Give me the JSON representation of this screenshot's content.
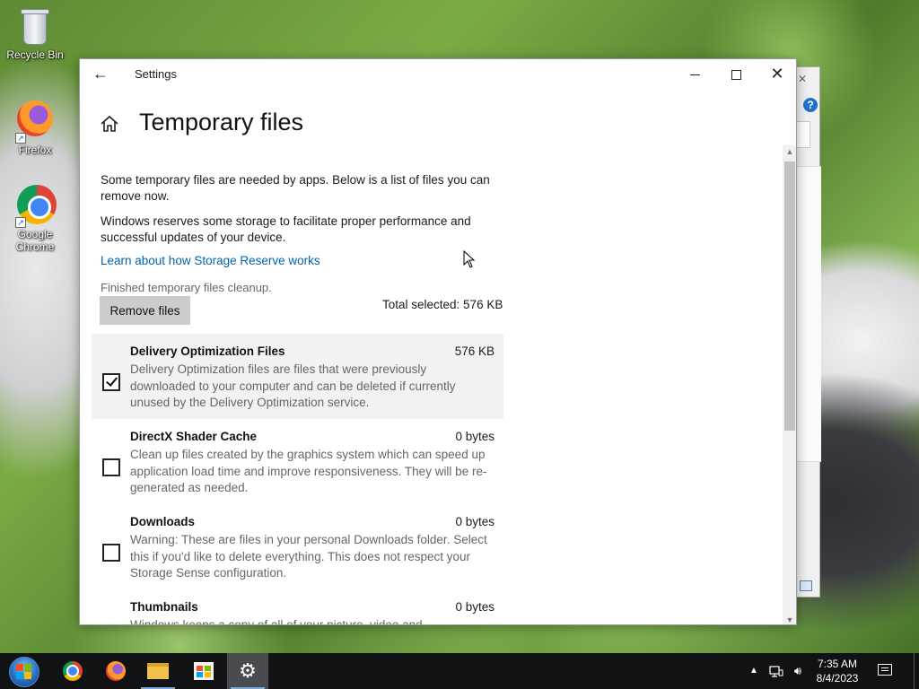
{
  "desktop": {
    "icons": [
      {
        "label": "Recycle Bin",
        "icon": "recycle-bin-icon"
      },
      {
        "label": "Firefox",
        "icon": "firefox-icon"
      },
      {
        "label": "Google Chrome",
        "icon": "chrome-icon"
      }
    ]
  },
  "window": {
    "title": "Settings",
    "back_icon": "back-arrow-icon",
    "minimize_icon": "minimize-icon",
    "maximize_icon": "maximize-icon",
    "close_icon": "close-icon"
  },
  "page": {
    "home_icon": "home-icon",
    "title": "Temporary files",
    "description_1": "Some temporary files are needed by apps. Below is a list of files you can remove now.",
    "description_2": "Windows reserves some storage to facilitate proper performance and successful updates of your device.",
    "link": "Learn about how Storage Reserve works",
    "status": "Finished temporary files cleanup.",
    "remove_button": "Remove files",
    "total_selected": "Total selected: 576 KB",
    "items": [
      {
        "name": "Delivery Optimization Files",
        "size": "576 KB",
        "checked": true,
        "description": "Delivery Optimization files are files that were previously downloaded to your computer and can be deleted if currently unused by the Delivery Optimization service."
      },
      {
        "name": "DirectX Shader Cache",
        "size": "0 bytes",
        "checked": false,
        "description": "Clean up files created by the graphics system which can speed up application load time and improve responsiveness. They will be re-generated as needed."
      },
      {
        "name": "Downloads",
        "size": "0 bytes",
        "checked": false,
        "description": "Warning: These are files in your personal Downloads folder. Select this if you'd like to delete everything. This does not respect your Storage Sense configuration."
      },
      {
        "name": "Thumbnails",
        "size": "0 bytes",
        "checked": false,
        "description": "Windows keeps a copy of all of your picture, video and"
      }
    ]
  },
  "taskbar": {
    "start_icon": "windows-start-icon",
    "apps": [
      {
        "name": "chrome-icon",
        "running": false,
        "active": false
      },
      {
        "name": "firefox-icon",
        "running": false,
        "active": false
      },
      {
        "name": "file-explorer-icon",
        "running": true,
        "active": false
      },
      {
        "name": "store-icon",
        "running": false,
        "active": false
      },
      {
        "name": "settings-gear-icon",
        "running": true,
        "active": true
      }
    ],
    "tray": {
      "show_hidden_icon": "chevron-up-icon",
      "network_icon": "network-icon",
      "volume_icon": "volume-icon",
      "time": "7:35 AM",
      "date": "8/4/2023",
      "notifications_icon": "action-center-icon"
    }
  }
}
